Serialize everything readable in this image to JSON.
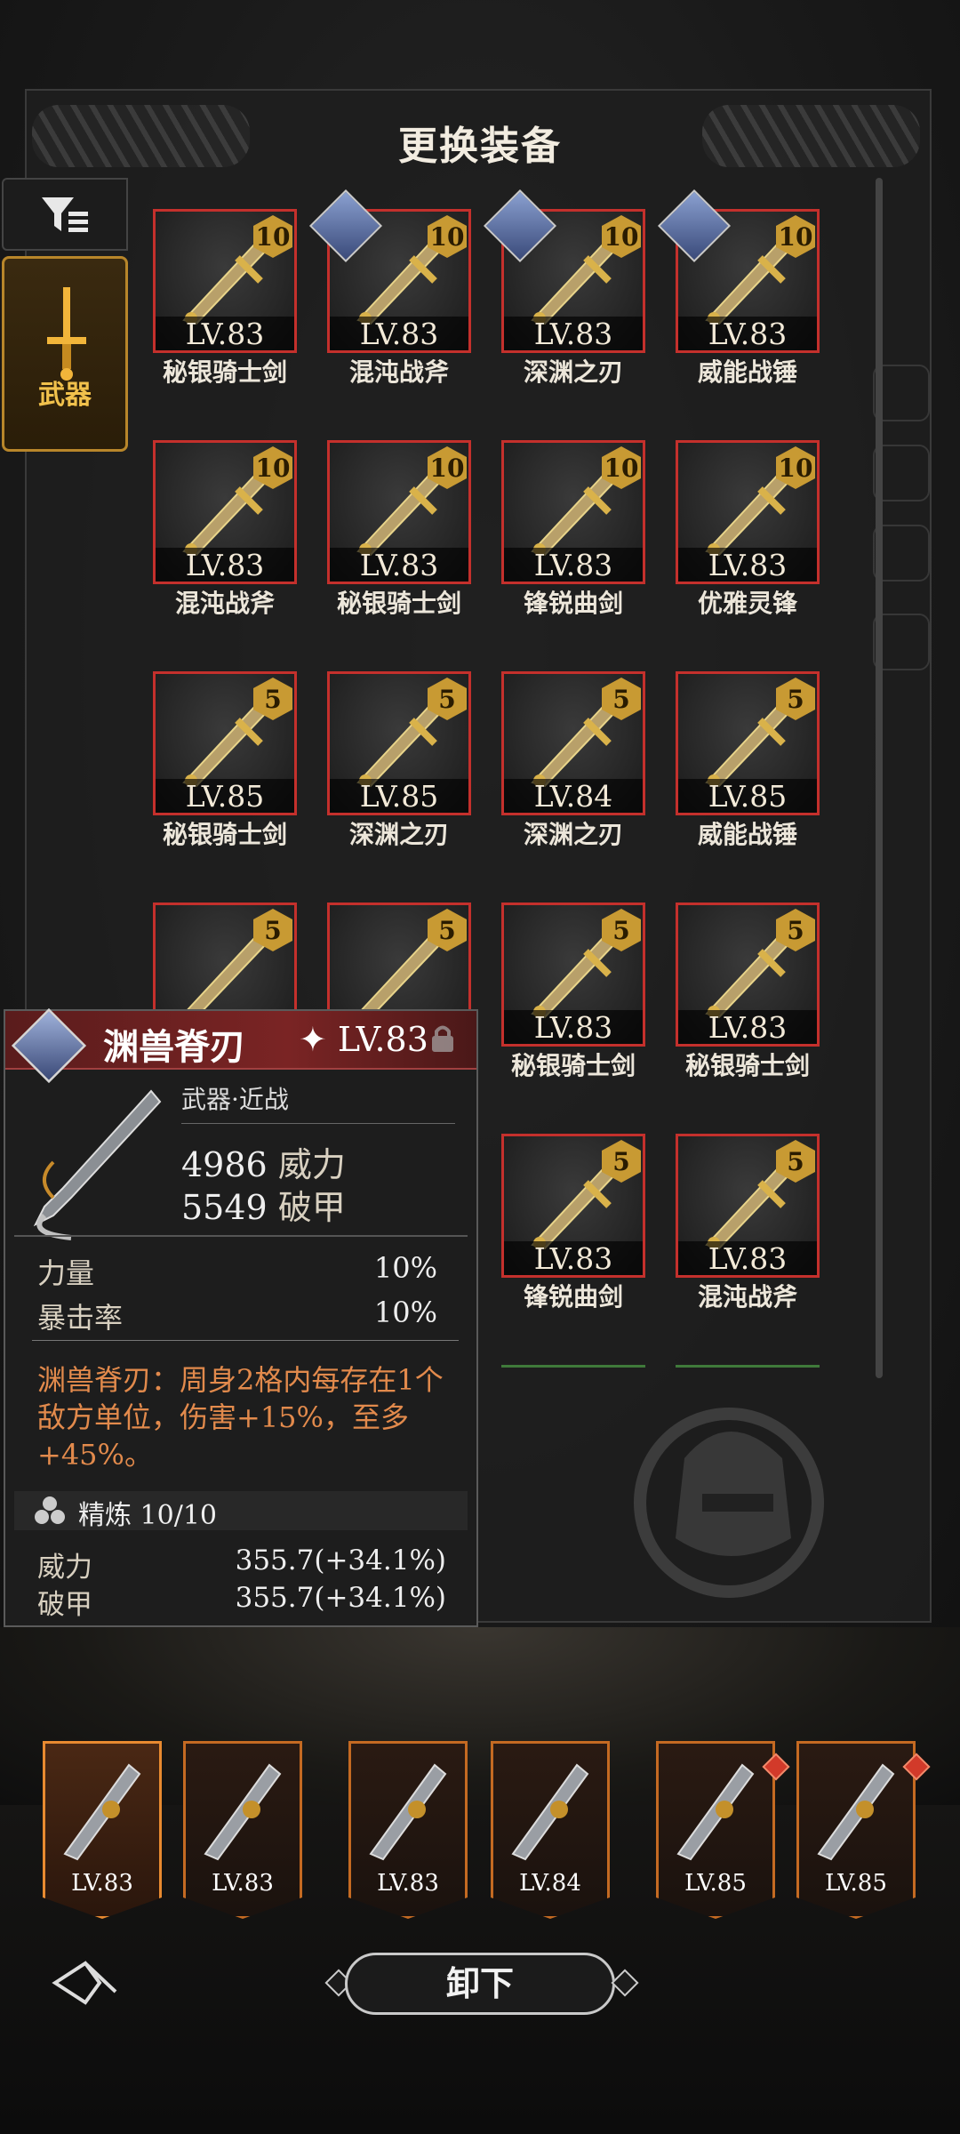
{
  "title": "更换装备",
  "filter": {
    "icon": "filter-icon"
  },
  "category_tab": {
    "label": "武器",
    "icon": "sword-icon"
  },
  "grid": [
    {
      "name": "秘银骑士剑",
      "level": "LV.83",
      "refine": "10",
      "owner": false
    },
    {
      "name": "混沌战斧",
      "level": "LV.83",
      "refine": "10",
      "owner": true
    },
    {
      "name": "深渊之刃",
      "level": "LV.83",
      "refine": "10",
      "owner": true
    },
    {
      "name": "威能战锤",
      "level": "LV.83",
      "refine": "10",
      "owner": true
    },
    {
      "name": "混沌战斧",
      "level": "LV.83",
      "refine": "10",
      "owner": false
    },
    {
      "name": "秘银骑士剑",
      "level": "LV.83",
      "refine": "10",
      "owner": false
    },
    {
      "name": "锋锐曲剑",
      "level": "LV.83",
      "refine": "10",
      "owner": false
    },
    {
      "name": "优雅灵锋",
      "level": "LV.83",
      "refine": "10",
      "owner": false
    },
    {
      "name": "秘银骑士剑",
      "level": "LV.85",
      "refine": "5",
      "owner": false
    },
    {
      "name": "深渊之刃",
      "level": "LV.85",
      "refine": "5",
      "owner": false
    },
    {
      "name": "深渊之刃",
      "level": "LV.84",
      "refine": "5",
      "owner": false
    },
    {
      "name": "威能战锤",
      "level": "LV.85",
      "refine": "5",
      "owner": false
    },
    {
      "name": "秘银骑士剑",
      "level": "LV.83",
      "refine": "5",
      "owner": false
    },
    {
      "name": "秘银骑士剑",
      "level": "LV.83",
      "refine": "5",
      "owner": false
    },
    {
      "name": "锋锐曲剑",
      "level": "LV.83",
      "refine": "5",
      "owner": false
    },
    {
      "name": "混沌战斧",
      "level": "LV.83",
      "refine": "5",
      "owner": false
    }
  ],
  "tooltip": {
    "name": "渊兽脊刃",
    "level": "LV.83",
    "type": "武器·近战",
    "stats": [
      {
        "value": "4986",
        "label": "威力"
      },
      {
        "value": "5549",
        "label": "破甲"
      }
    ],
    "attributes": [
      {
        "label": "力量",
        "value": "10%"
      },
      {
        "label": "暴击率",
        "value": "10%"
      }
    ],
    "skill": "渊兽脊刃：周身2格内每存在1个敌方单位，伤害+15%，至多+45%。",
    "refine_label": "精炼 10/10",
    "refine_stats": [
      {
        "label": "威力",
        "value": "355.7(+34.1%)"
      },
      {
        "label": "破甲",
        "value": "355.7(+34.1%)"
      }
    ]
  },
  "equipped": [
    {
      "level": "LV.83",
      "icon": "blade-icon",
      "alert": false
    },
    {
      "level": "LV.83",
      "icon": "sword-icon",
      "alert": false
    },
    {
      "level": "LV.83",
      "icon": "boots-icon",
      "alert": false
    },
    {
      "level": "LV.84",
      "icon": "helmet-icon",
      "alert": false
    },
    {
      "level": "LV.85",
      "icon": "ring-icon",
      "alert": true
    },
    {
      "level": "LV.85",
      "icon": "dagger-icon",
      "alert": true
    }
  ],
  "unequip_label": "卸下"
}
